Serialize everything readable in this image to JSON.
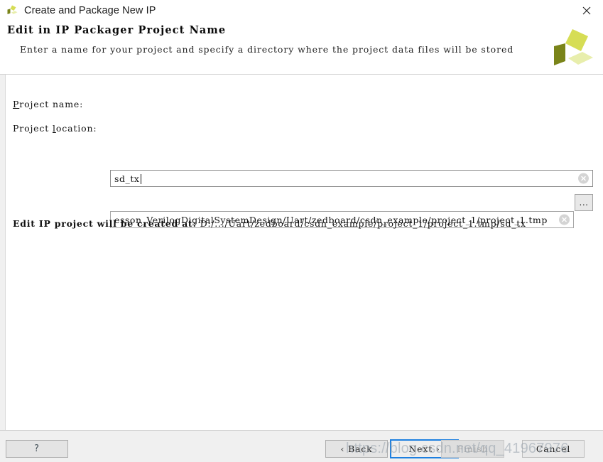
{
  "window": {
    "title": "Create and Package New IP",
    "logo_icon": "xilinx-logo-icon",
    "close_icon": "close-icon"
  },
  "header": {
    "title": "Edit in IP Packager Project Name",
    "description": "Enter a name for your project and specify a directory where the project data files will be stored",
    "logo_icon": "xilinx-logo-icon"
  },
  "form": {
    "project_name": {
      "label_prefix": "P",
      "label_rest": "roject name:",
      "value": "sd_tx",
      "clear_icon": "clear-circle-icon"
    },
    "project_location": {
      "label_start": "Project ",
      "label_mnemonic": "l",
      "label_rest": "ocation:",
      "value": "esson_VerilogDigitalSystemDesign/Uart/zedboard/csdn_example/project_1/project_1.tmp",
      "clear_icon": "clear-circle-icon",
      "browse_label": "...",
      "browse_icon": "ellipsis-icon"
    }
  },
  "status": {
    "prefix": "Edit IP project will be created at:",
    "path": "D:/.../Uart/zedboard/csdn_example/project_1/project_1.tmp/sd_tx"
  },
  "footer": {
    "help_label": "?",
    "back_label": "‹  Back",
    "back_mnemonic": "B",
    "next_label": "Next  ›",
    "next_mnemonic": "N",
    "finish_label": "Finish",
    "cancel_label": "Cancel",
    "cancel_mnemonic": "C"
  },
  "watermark": {
    "text": "https://blog.csdn.net/qq_41967976"
  },
  "colors": {
    "accent_focus": "#1d7fe0",
    "logo_dark": "#7a8419",
    "logo_mid": "#d6dd55",
    "logo_light": "#e8eeac",
    "window_bg": "#f0f0f0",
    "content_bg": "#ffffff"
  }
}
